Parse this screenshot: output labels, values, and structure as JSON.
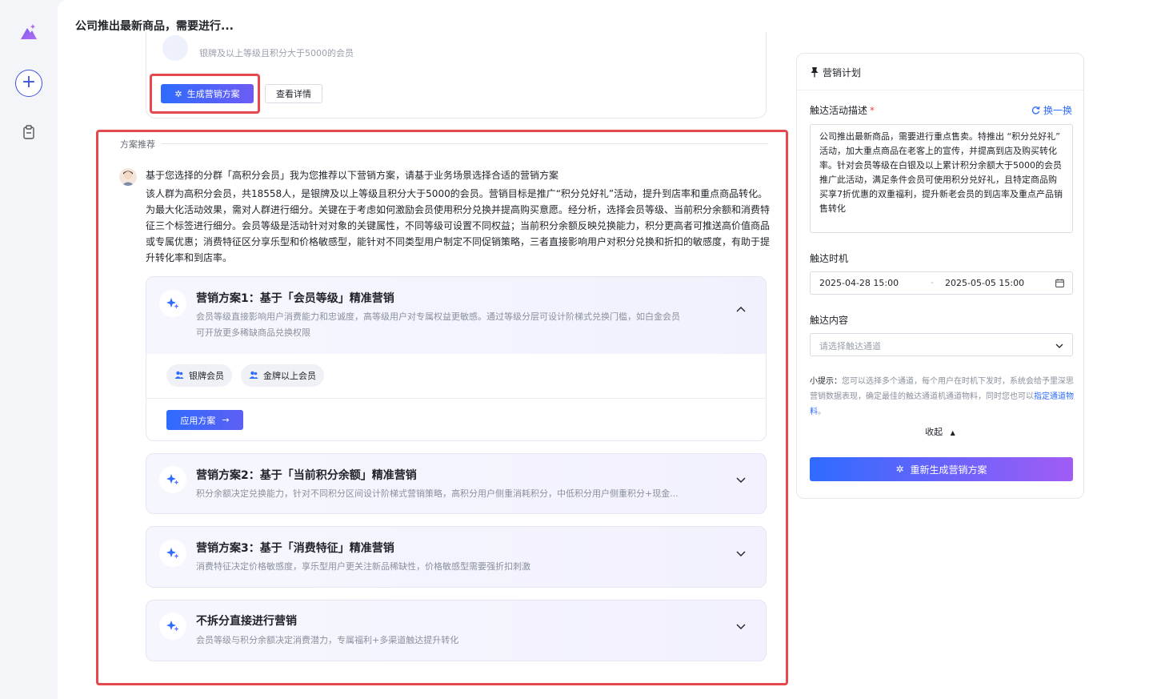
{
  "page": {
    "title": "公司推出最新商品，需要进行..."
  },
  "rail": {
    "logo_icon": "mountain-sparkle-icon",
    "new_icon": "plus-icon",
    "clipboard_icon": "clipboard-icon"
  },
  "prev_card": {
    "ghost_text": "银牌及以上等级且积分大于5000的会员",
    "generate_label": "生成营销方案",
    "detail_label": "查看详情"
  },
  "recommend": {
    "section_label": "方案推荐",
    "intro": "基于您选择的分群「高积分会员」我为您推荐以下营销方案，请基于业务场景选择合适的营销方案",
    "paragraph": "该人群为高积分会员，共18558人，是银牌及以上等级且积分大于5000的会员。营销目标是推广“积分兑好礼”活动，提升到店率和重点商品转化。为最大化活动效果，需对人群进行细分。关键在于考虑如何激励会员使用积分兑换并提高购买意愿。经分析，选择会员等级、当前积分余额和消费特征三个标签进行细分。会员等级是活动针对对象的关键属性，不同等级可设置不同权益；当前积分余额反映兑换能力，积分更高者可推送高价值商品或专属优惠；消费特征区分享乐型和价格敏感型，能针对不同类型用户制定不同促销策略，三者直接影响用户对积分兑换和折扣的敏感度，有助于提升转化率和到店率。"
  },
  "plans": [
    {
      "title": "营销方案1：基于「会员等级」精准营销",
      "desc_line1": "会员等级直接影响用户消费能力和忠诚度，高等级用户对专属权益更敏感。通过等级分层可设计阶梯式兑换门槛，如白金会员",
      "desc_line2": "可开放更多稀缺商品兑换权限",
      "tags": [
        "银牌会员",
        "金牌以上会员"
      ],
      "apply_label": "应用方案"
    },
    {
      "title": "营销方案2：基于「当前积分余额」精准营销",
      "desc": "积分余额决定兑换能力，针对不同积分区间设计阶梯式营销策略，高积分用户侧重消耗积分，中低积分用户侧重积分+现金..."
    },
    {
      "title": "营销方案3：基于「消费特征」精准营销",
      "desc": "消费特征决定价格敏感度，享乐型用户更关注新品稀缺性，价格敏感型需要强折扣刺激"
    },
    {
      "title": "不拆分直接进行营销",
      "desc": "会员等级与积分余额决定消费潜力，专属福利+多渠道触达提升转化"
    }
  ],
  "right_panel": {
    "title": "营销计划",
    "desc_label": "触达活动描述",
    "required_mark": "*",
    "swap_label": "换一换",
    "desc_value": "公司推出最新商品，需要进行重点售卖。特推出 “积分兑好礼” 活动，加大重点商品在老客上的宣传，并提高到店及购买转化率。针对会员等级在白银及以上累计积分余额大于5000的会员推广此活动，满足条件会员可使用积分兑好礼，且特定商品购买享7折优惠的双重福利，提升新老会员的到店率及重点产品销售转化",
    "time_label": "触达时机",
    "start": "2025-04-28 15:00",
    "sep": "-",
    "end": "2025-05-05 15:00",
    "content_label": "触达内容",
    "channel_placeholder": "请选择触达通道",
    "tip_label": "小提示：",
    "tip_text": "您可以选择多个通道，每个用户在时机下发时，系统会给予里深思营销数据表现，确定最佳的触达通道机通道物料，同时您也可以",
    "tip_link": "指定通道物料",
    "tip_end": "。",
    "collapse_label": "收起",
    "regen_label": "重新生成营销方案"
  },
  "colors": {
    "accent": "#2f6bff",
    "highlight": "#e5484d",
    "purple": "#a15cf5"
  }
}
